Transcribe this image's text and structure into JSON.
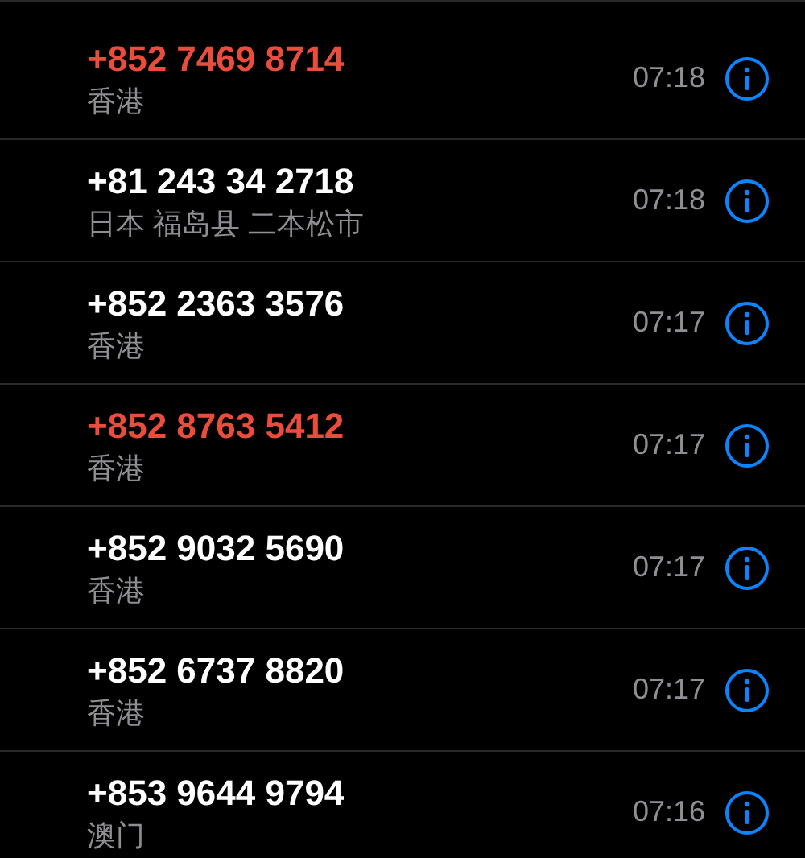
{
  "calls": [
    {
      "number": "+852 7469 8714",
      "location": "香港",
      "time": "07:18",
      "missed": true
    },
    {
      "number": "+81 243 34 2718",
      "location": "日本 福岛县 二本松市",
      "time": "07:18",
      "missed": false
    },
    {
      "number": "+852 2363 3576",
      "location": "香港",
      "time": "07:17",
      "missed": false
    },
    {
      "number": "+852 8763 5412",
      "location": "香港",
      "time": "07:17",
      "missed": true
    },
    {
      "number": "+852 9032 5690",
      "location": "香港",
      "time": "07:17",
      "missed": false
    },
    {
      "number": "+852 6737 8820",
      "location": "香港",
      "time": "07:17",
      "missed": false
    },
    {
      "number": "+853 9644 9794",
      "location": "澳门",
      "time": "07:16",
      "missed": false
    }
  ]
}
